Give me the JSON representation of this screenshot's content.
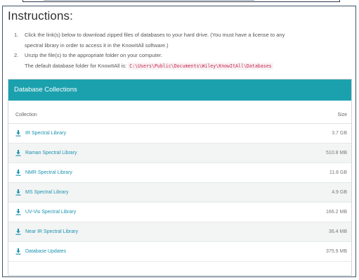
{
  "page": {
    "heading": "Instructions:",
    "instructions": [
      {
        "num": "1.",
        "text": "Click the link(s) below to download zipped files of databases to your hard drive. (You must have a license to any",
        "continuation": "spectral library in order to access it in the KnowItAll software.)"
      },
      {
        "num": "2.",
        "text": "Unzip the file(s) to the appropriate folder on your computer.",
        "continuation_prefix": "The default database folder for KnowItAll is:",
        "path": "C:\\Users\\Public\\Documents\\Wiley\\KnowItAll\\Databases"
      }
    ]
  },
  "collections": {
    "header": "Database Collections",
    "columns": {
      "collection": "Collection",
      "size": "Size"
    },
    "download_icon": "download-icon",
    "accent_color": "#1ba1ae",
    "link_color": "#1a93b0",
    "rows": [
      {
        "name": "IR Spectral Library",
        "size": "3.7 GB"
      },
      {
        "name": "Raman Spectral Library",
        "size": "510.8 MB"
      },
      {
        "name": "NMR Spectral Library",
        "size": "11.8 GB"
      },
      {
        "name": "MS Spectral Library",
        "size": "4.9 GB"
      },
      {
        "name": "UV-Vis Spectral Library",
        "size": "166.2 MB"
      },
      {
        "name": "Near IR Spectral Library",
        "size": "36.4 MB"
      },
      {
        "name": "Database Updates",
        "size": "375.9 MB"
      }
    ]
  }
}
